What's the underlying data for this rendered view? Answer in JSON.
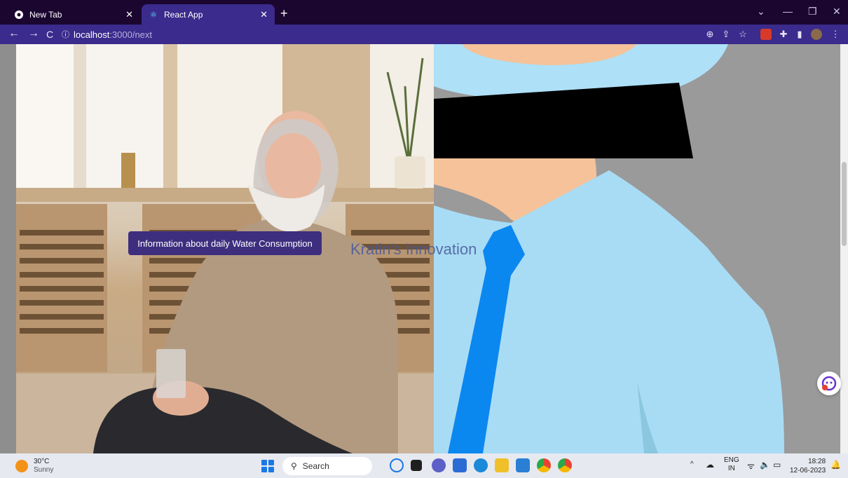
{
  "browser": {
    "tabs": [
      {
        "label": "New Tab",
        "active": false
      },
      {
        "label": "React App",
        "active": true
      }
    ],
    "url_host": "localhost",
    "url_path": ":3000/next"
  },
  "page": {
    "info_button_label": "Information about daily Water Consumption",
    "brand_text": "Kratin's Innovation"
  },
  "taskbar": {
    "weather_temp": "30°C",
    "weather_desc": "Sunny",
    "search_label": "Search",
    "lang_top": "ENG",
    "lang_bottom": "IN",
    "time": "18:28",
    "date": "12-06-2023"
  },
  "colors": {
    "tabbar": "#1b0630",
    "toolbar": "#3a2b8c",
    "button": "#3e2e7e",
    "shirt": "#a8dcf5",
    "tie": "#0b87f0"
  }
}
